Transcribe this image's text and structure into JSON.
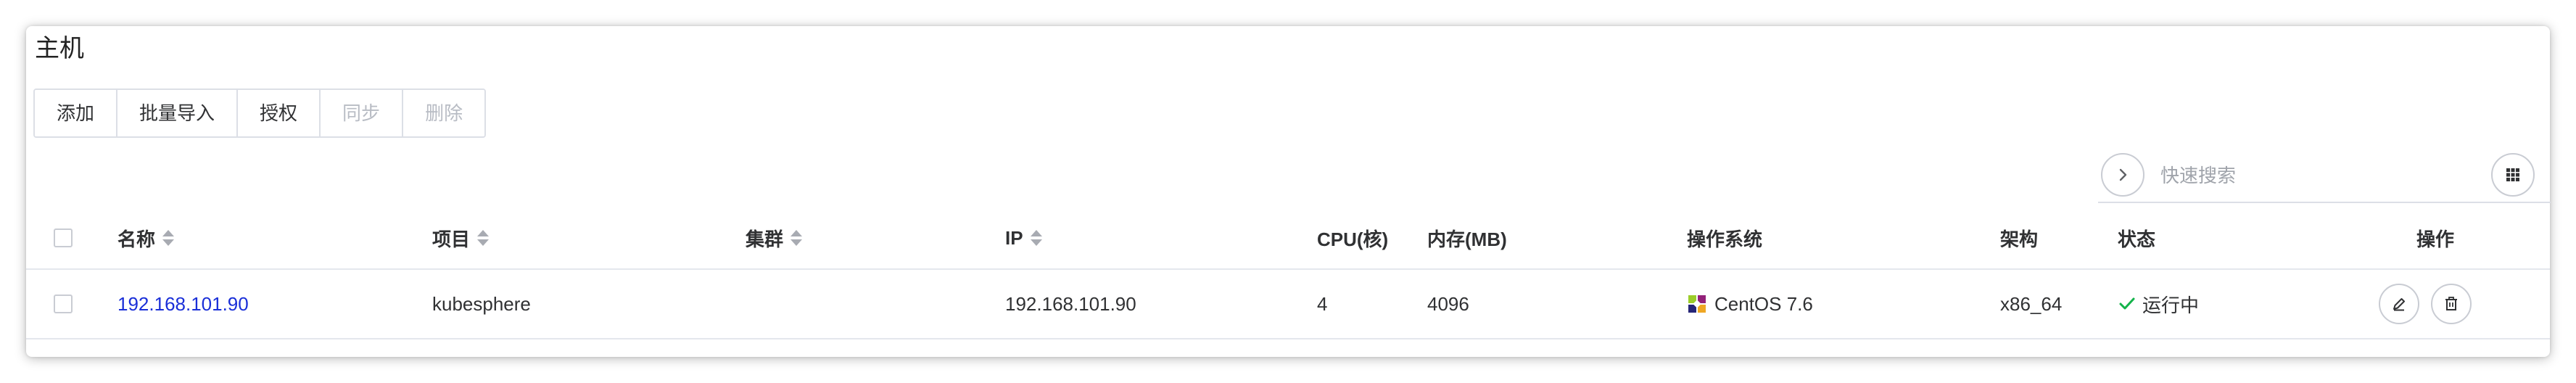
{
  "page": {
    "title": "主机"
  },
  "toolbar": {
    "buttons": [
      {
        "label": "添加",
        "disabled": false
      },
      {
        "label": "批量导入",
        "disabled": false
      },
      {
        "label": "授权",
        "disabled": false
      },
      {
        "label": "同步",
        "disabled": true
      },
      {
        "label": "删除",
        "disabled": true
      }
    ]
  },
  "search": {
    "placeholder": "快速搜索",
    "value": "",
    "go_icon": "chevron-right-icon",
    "columns_icon": "grid-icon"
  },
  "table": {
    "headers": {
      "name": "名称",
      "project": "项目",
      "cluster": "集群",
      "ip": "IP",
      "cpu": "CPU(核)",
      "memory": "内存(MB)",
      "os": "操作系统",
      "arch": "架构",
      "status": "状态",
      "actions": "操作"
    },
    "rows": [
      {
        "name": "192.168.101.90",
        "project": "kubesphere",
        "cluster": "",
        "ip": "192.168.101.90",
        "cpu": "4",
        "memory": "4096",
        "os": "CentOS 7.6",
        "os_icon": "centos-icon",
        "arch": "x86_64",
        "status": "运行中",
        "status_icon": "check-icon",
        "action_icons": [
          "edit-icon",
          "delete-icon"
        ]
      }
    ]
  },
  "colors": {
    "link": "#1a2fd8",
    "status_ok": "#13b34a",
    "border": "#dcdfe6",
    "disabled_text": "#b8bcc4"
  }
}
